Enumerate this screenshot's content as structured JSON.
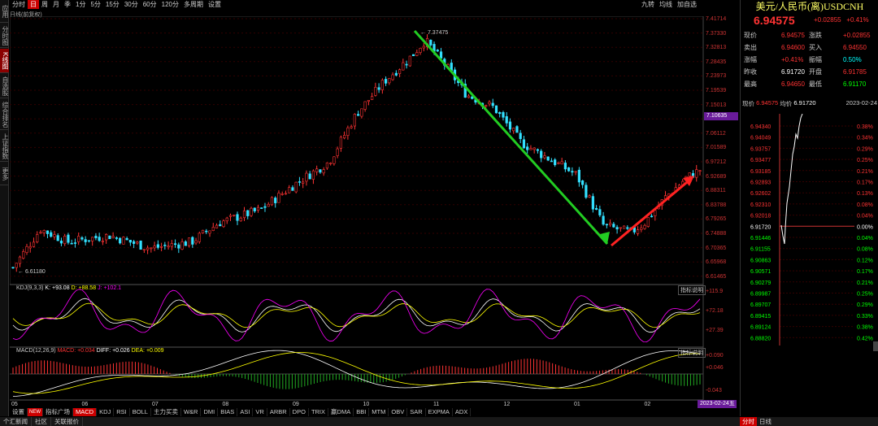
{
  "left_sidebar": [
    "应用",
    "分时图",
    "K线图",
    "自选股",
    "综合排名",
    "上证指数",
    "更多"
  ],
  "period_tabs": [
    "分时",
    "日",
    "周",
    "月",
    "季",
    "1分",
    "5分",
    "15分",
    "30分",
    "60分",
    "120分",
    "多周期",
    "设置"
  ],
  "right_tools": [
    "九转",
    "均线",
    "加自选"
  ],
  "subtitle": "日线(前复权)",
  "price_axis": [
    "7.41714",
    "7.37330",
    "7.32813",
    "7.28435",
    "7.23973",
    "7.19539",
    "7.15013",
    "7.10635",
    "7.06112",
    "7.01589",
    "6.97212",
    "6.92689",
    "6.88311",
    "6.83788",
    "6.79265",
    "6.74888",
    "6.70365",
    "6.65968",
    "6.61465"
  ],
  "highlight_price": "7.10635",
  "high_label": "7.37475",
  "low_label": "6.61180",
  "kdj": {
    "label": "KDJ(9,3,3)",
    "k": "K: +93.08",
    "d": "D: +88.58",
    "j": "J: +102.1",
    "axis": [
      "+115.9",
      "+72.18",
      "+27.39"
    ]
  },
  "macd": {
    "label": "MACD(12,26,9)",
    "macd": "MACD: +0.034",
    "diff": "DIFF: +0.026",
    "dea": "DEA: +0.009",
    "axis": [
      "+0.090",
      "+0.046",
      "-0.043"
    ]
  },
  "indicator_btn": "指标说明",
  "months": [
    "05",
    "06",
    "07",
    "08",
    "09",
    "10",
    "11",
    "12",
    "01",
    "02"
  ],
  "date_box": "2023-02-24五",
  "bottom_tabs": [
    "设置",
    "NEW",
    "指标广场",
    "MACD",
    "KDJ",
    "RSI",
    "BOLL",
    "主力买卖",
    "W&R",
    "DMI",
    "BIAS",
    "ASI",
    "VR",
    "ARBR",
    "DPO",
    "TRIX",
    "赢DMA",
    "BBI",
    "MTM",
    "OBV",
    "SAR",
    "EXPMA",
    "ADX"
  ],
  "status_items": [
    "个汇新闻",
    "社区",
    "关联报价"
  ],
  "quote": {
    "title": "美元/人民币(离)USDCNH",
    "price": "6.94575",
    "change": "+0.02855",
    "pct": "+0.41%",
    "rows": [
      {
        "l1": "现价",
        "v1": "6.94575",
        "l2": "涨跌",
        "v2": "+0.02855"
      },
      {
        "l1": "卖出",
        "v1": "6.94600",
        "l2": "买入",
        "v2": "6.94550"
      },
      {
        "l1": "涨幅",
        "v1": "+0.41%",
        "l2": "振幅",
        "v2": "0.50%"
      },
      {
        "l1": "昨收",
        "v1": "6.91720",
        "l2": "开盘",
        "v2": "6.91785"
      },
      {
        "l1": "最高",
        "v1": "6.94650",
        "l2": "最低",
        "v2": "6.91170"
      }
    ],
    "mini_label1": "现价",
    "mini_val1": "6.94575",
    "mini_label2": "均价",
    "mini_val2": "6.91720",
    "mini_date": "2023-02-24",
    "mini_left": [
      "6.94340",
      "6.94049",
      "6.93757",
      "6.93477",
      "6.93185",
      "6.92893",
      "6.92602",
      "6.92310",
      "6.92018",
      "6.91720",
      "6.91446",
      "6.91155",
      "6.90863",
      "6.90571",
      "6.90279",
      "6.89987",
      "6.89707",
      "6.89415",
      "6.89124",
      "6.88820"
    ],
    "mini_right": [
      "0.38%",
      "0.34%",
      "0.29%",
      "0.25%",
      "0.21%",
      "0.17%",
      "0.13%",
      "0.08%",
      "0.04%",
      "0.00%",
      "0.04%",
      "0.08%",
      "0.12%",
      "0.17%",
      "0.21%",
      "0.25%",
      "0.29%",
      "0.33%",
      "0.38%",
      "0.42%"
    ],
    "mini_tabs": [
      "分时",
      "日线"
    ]
  },
  "colors": {
    "up": "#ff3333",
    "down": "#33e0ff",
    "macd_up": "#ff3333",
    "macd_down": "#22aa22",
    "k": "#ffffff",
    "d": "#ffff00",
    "j": "#ff00ff"
  }
}
